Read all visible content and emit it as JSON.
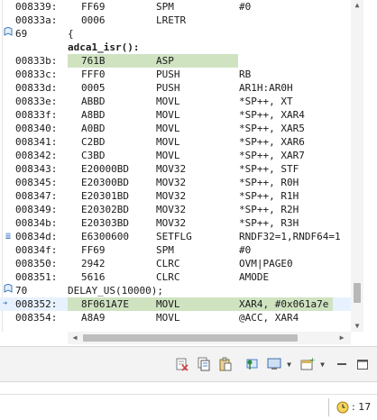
{
  "disassembly": {
    "lines": [
      {
        "type": "asm",
        "addr": "008339:",
        "opcode": "FF69",
        "mnemonic": "SPM",
        "args": "#0"
      },
      {
        "type": "asm",
        "addr": "00833a:",
        "opcode": "0006",
        "mnemonic": "LRETR",
        "args": ""
      },
      {
        "type": "src",
        "lineno": "69",
        "code": "{",
        "marker": "bookmark"
      },
      {
        "type": "label",
        "text": "adca1_isr():"
      },
      {
        "type": "asm",
        "addr": "00833b:",
        "opcode": "761B",
        "mnemonic": "ASP",
        "args": "",
        "highlight": true
      },
      {
        "type": "asm",
        "addr": "00833c:",
        "opcode": "FFF0",
        "mnemonic": "PUSH",
        "args": "RB"
      },
      {
        "type": "asm",
        "addr": "00833d:",
        "opcode": "0005",
        "mnemonic": "PUSH",
        "args": "AR1H:AR0H"
      },
      {
        "type": "asm",
        "addr": "00833e:",
        "opcode": "ABBD",
        "mnemonic": "MOVL",
        "args": "*SP++, XT"
      },
      {
        "type": "asm",
        "addr": "00833f:",
        "opcode": "A8BD",
        "mnemonic": "MOVL",
        "args": "*SP++, XAR4"
      },
      {
        "type": "asm",
        "addr": "008340:",
        "opcode": "A0BD",
        "mnemonic": "MOVL",
        "args": "*SP++, XAR5"
      },
      {
        "type": "asm",
        "addr": "008341:",
        "opcode": "C2BD",
        "mnemonic": "MOVL",
        "args": "*SP++, XAR6"
      },
      {
        "type": "asm",
        "addr": "008342:",
        "opcode": "C3BD",
        "mnemonic": "MOVL",
        "args": "*SP++, XAR7"
      },
      {
        "type": "asm",
        "addr": "008343:",
        "opcode": "E20000BD",
        "mnemonic": "MOV32",
        "args": "*SP++, STF"
      },
      {
        "type": "asm",
        "addr": "008345:",
        "opcode": "E20300BD",
        "mnemonic": "MOV32",
        "args": "*SP++, R0H"
      },
      {
        "type": "asm",
        "addr": "008347:",
        "opcode": "E20301BD",
        "mnemonic": "MOV32",
        "args": "*SP++, R1H"
      },
      {
        "type": "asm",
        "addr": "008349:",
        "opcode": "E20302BD",
        "mnemonic": "MOV32",
        "args": "*SP++, R2H"
      },
      {
        "type": "asm",
        "addr": "00834b:",
        "opcode": "E20303BD",
        "mnemonic": "MOV32",
        "args": "*SP++, R3H"
      },
      {
        "type": "asm",
        "addr": "00834d:",
        "opcode": "E6300600",
        "mnemonic": "SETFLG",
        "args": "RNDF32=1,RNDF64=1",
        "marker": "list"
      },
      {
        "type": "asm",
        "addr": "00834f:",
        "opcode": "FF69",
        "mnemonic": "SPM",
        "args": "#0"
      },
      {
        "type": "asm",
        "addr": "008350:",
        "opcode": "2942",
        "mnemonic": "CLRC",
        "args": "OVM|PAGE0"
      },
      {
        "type": "asm",
        "addr": "008351:",
        "opcode": "5616",
        "mnemonic": "CLRC",
        "args": "AMODE"
      },
      {
        "type": "src",
        "lineno": "70",
        "code": "DELAY_US(10000);",
        "marker": "bookmark"
      },
      {
        "type": "asm",
        "addr": "008352:",
        "opcode": "8F061A7E",
        "mnemonic": "MOVL",
        "args": "XAR4, #0x061a7e",
        "highlight": true,
        "current": true
      },
      {
        "type": "asm",
        "addr": "008354:",
        "opcode": "A8A9",
        "mnemonic": "MOVL",
        "args": "@ACC, XAR4"
      }
    ]
  },
  "toolbar": {
    "icons": [
      "clear-icon",
      "copy-icon",
      "paste-icon",
      "pin-icon",
      "display-icon",
      "new-view-icon",
      "minimize-icon",
      "maximize-icon"
    ]
  },
  "statusbar": {
    "value": ": 17"
  },
  "colors": {
    "highlight": "#cfe3c1",
    "current_line": "#e8f2fe",
    "marker": "#3a78c0"
  }
}
